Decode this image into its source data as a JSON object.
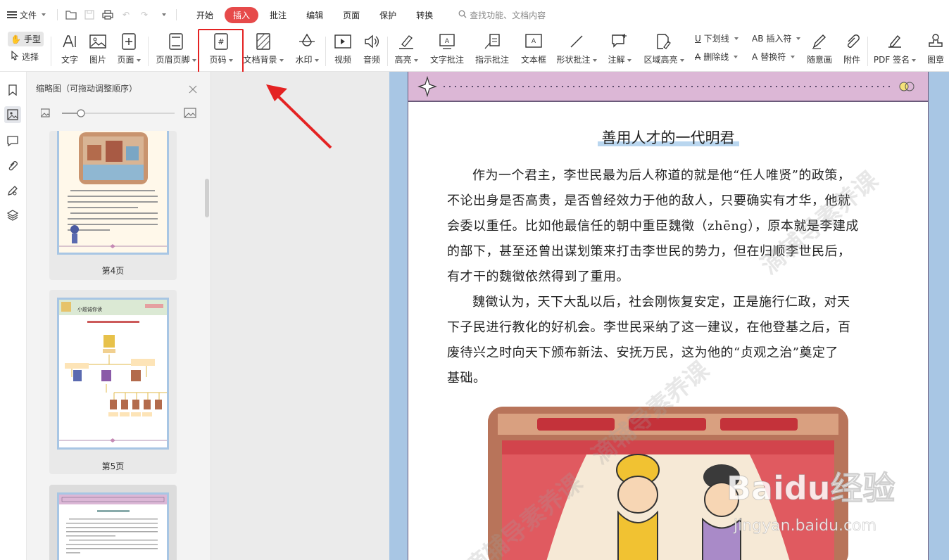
{
  "menubar": {
    "file_label": "文件",
    "tabs": [
      {
        "label": "开始"
      },
      {
        "label": "插入"
      },
      {
        "label": "批注"
      },
      {
        "label": "编辑"
      },
      {
        "label": "页面"
      },
      {
        "label": "保护"
      },
      {
        "label": "转换"
      }
    ],
    "search_placeholder": "查找功能、文档内容"
  },
  "ribbon": {
    "hand": "手型",
    "select": "选择",
    "text": "文字",
    "image": "图片",
    "page": "页面",
    "header_footer": "页眉页脚",
    "page_number": "页码",
    "background": "文档背景",
    "watermark": "水印",
    "video": "视频",
    "audio": "音频",
    "highlight": "高亮",
    "text_note": "文字批注",
    "pointer_note": "指示批注",
    "textbox": "文本框",
    "shape_note": "形状批注",
    "comment": "注解",
    "area_highlight": "区域高亮",
    "underline": "下划线",
    "strikethrough": "删除线",
    "insert_char": "插入符",
    "replace_char": "替换符",
    "freehand": "随意画",
    "attachment": "附件",
    "pdf_sign": "PDF 签名",
    "stamp": "图章"
  },
  "thumb_panel": {
    "title": "缩略图（可拖动调整顺序）",
    "pages": [
      {
        "label": "第4页"
      },
      {
        "label": "第5页"
      }
    ],
    "page5_heading": "小题诚你读"
  },
  "document": {
    "title": "善用人才的一代明君",
    "paragraphs": [
      {
        "lines": [
          "作为一个君主，李世民最为后人称道的就是他“任人唯贤”的政策，",
          "不论出身是否高贵，是否曾经效力于他的敌人，只要确实有才华，他就",
          "会委以重任。比如他最信任的朝中重臣魏徵（zhēng），原本就是李建成",
          "的部下，甚至还曾出谋划策来打击李世民的势力，但在归顺李世民后，",
          "有才干的魏徵依然得到了重用。"
        ]
      },
      {
        "lines": [
          "魏徵认为，天下大乱以后，社会刚恢复安定，正是施行仁政，对天",
          "下子民进行教化的好机会。李世民采纳了这一建议，在他登基之后，百",
          "废待兴之时向天下颁布新法、安抚万民，这为他的“贞观之治”奠定了",
          "基础。"
        ]
      }
    ]
  },
  "watermarks": {
    "brand": "滴辅导素养课",
    "baidu_logo": "Baidu经验",
    "baidu_url": "jingyan.baidu.com"
  },
  "colors": {
    "accent": "#e64a4a",
    "highlight_box": "#e42222",
    "page_border": "#a8c6e4",
    "header_band": "#dcb7d6"
  }
}
